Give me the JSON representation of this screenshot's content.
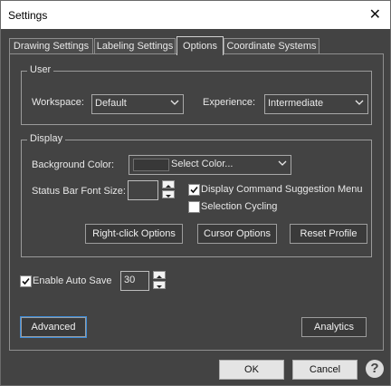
{
  "window": {
    "title": "Settings",
    "close_glyph": "✕"
  },
  "tabs": [
    {
      "label": "Drawing Settings"
    },
    {
      "label": "Labeling Settings"
    },
    {
      "label": "Options"
    },
    {
      "label": "Coordinate Systems"
    }
  ],
  "user_group": {
    "legend": "User",
    "workspace_label": "Workspace:",
    "workspace_value": "Default",
    "experience_label": "Experience:",
    "experience_value": "Intermediate"
  },
  "display_group": {
    "legend": "Display",
    "bg_color_label": "Background Color:",
    "bg_color_value": "Select Color...",
    "bg_color_swatch": "#383838",
    "font_size_label": "Status Bar Font Size:",
    "font_size_value": "",
    "cmd_suggestion_label": "Display Command Suggestion Menu",
    "cmd_suggestion_checked": true,
    "selection_cycling_label": "Selection Cycling",
    "selection_cycling_checked": false,
    "right_click_button": "Right-click Options",
    "cursor_button": "Cursor Options",
    "reset_button": "Reset Profile"
  },
  "autosave": {
    "label": "Enable Auto Save",
    "checked": true,
    "value": "30"
  },
  "advanced_button": "Advanced",
  "analytics_button": "Analytics",
  "footer": {
    "ok": "OK",
    "cancel": "Cancel",
    "help": "?"
  },
  "colors": {
    "background": "#434343",
    "focus_outline": "#3c8ddb"
  }
}
